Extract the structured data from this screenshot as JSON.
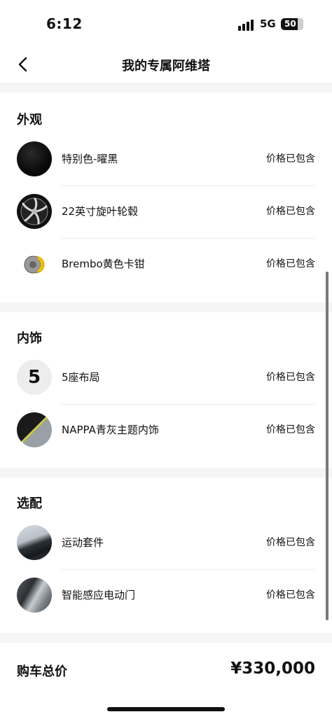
{
  "status": {
    "time": "6:12",
    "network": "5G",
    "battery": "50"
  },
  "nav": {
    "title": "我的专属阿维塔",
    "back_icon": "chevron-left-icon"
  },
  "sections": {
    "exterior": {
      "title": "外观",
      "items": [
        {
          "name": "特别色-曜黑",
          "price": "价格已包含",
          "thumb": "black-paint-swatch"
        },
        {
          "name": "22英寸旋叶轮毂",
          "price": "价格已包含",
          "thumb": "wheel-rim-icon"
        },
        {
          "name": "Brembo黄色卡钳",
          "price": "价格已包含",
          "thumb": "yellow-caliper-icon"
        }
      ]
    },
    "interior": {
      "title": "内饰",
      "items": [
        {
          "name": "5座布局",
          "price": "价格已包含",
          "badge": "5"
        },
        {
          "name": "NAPPA青灰主题内饰",
          "price": "价格已包含",
          "thumb": "nappa-leather-swatch"
        }
      ]
    },
    "options": {
      "title": "选配",
      "items": [
        {
          "name": "运动套件",
          "price": "价格已包含",
          "thumb": "sport-kit-photo"
        },
        {
          "name": "智能感应电动门",
          "price": "价格已包含",
          "thumb": "power-door-photo"
        }
      ]
    }
  },
  "total": {
    "label": "购车总价",
    "value": "¥330,000"
  }
}
